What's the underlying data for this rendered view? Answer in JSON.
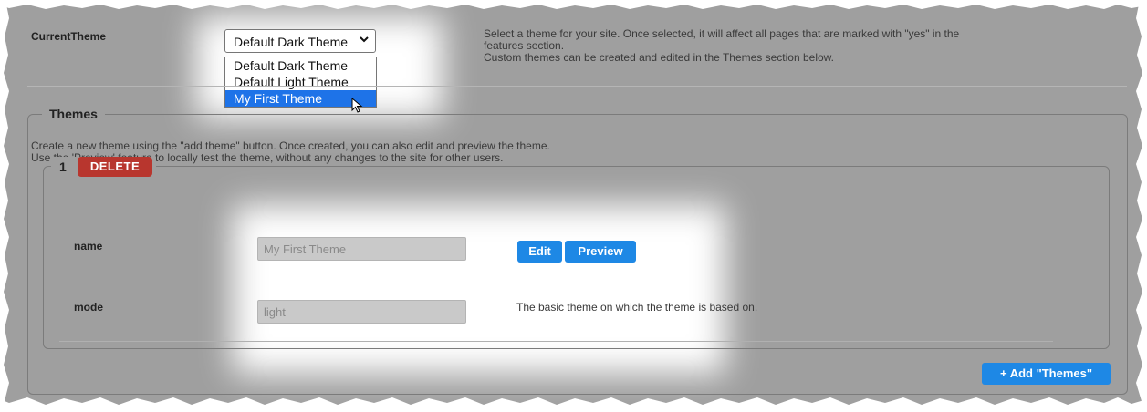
{
  "current_theme": {
    "label": "CurrentTheme",
    "selected_value": "Default Dark Theme",
    "options": [
      "Default Dark Theme",
      "Default Light Theme",
      "My First Theme"
    ],
    "highlighted_option": "My First Theme",
    "description_line1": "Select a theme for your site. Once selected, it will affect all pages that are marked with \"yes\" in the",
    "description_line2": "features section.",
    "description_line3": "Custom themes can be created and edited in the Themes section below."
  },
  "themes": {
    "legend": "Themes",
    "intro_line1": "Create a new theme using the \"add theme\" button. Once created, you can also edit and preview the theme.",
    "intro_line2": "Use the 'Preview' feature to locally test the theme, without any changes to the site for other users.",
    "items": [
      {
        "index": "1",
        "delete_label": "DELETE",
        "name_label": "name",
        "name_placeholder": "My First Theme",
        "edit_label": "Edit",
        "preview_label": "Preview",
        "mode_label": "mode",
        "mode_placeholder": "light",
        "mode_description": "The basic theme on which the theme is based on."
      }
    ],
    "add_label": "+ Add \"Themes\""
  },
  "colors": {
    "background": "#9f9f9f",
    "delete": "#b8362e",
    "primary": "#1e88e5",
    "highlight": "#1e73e8"
  }
}
